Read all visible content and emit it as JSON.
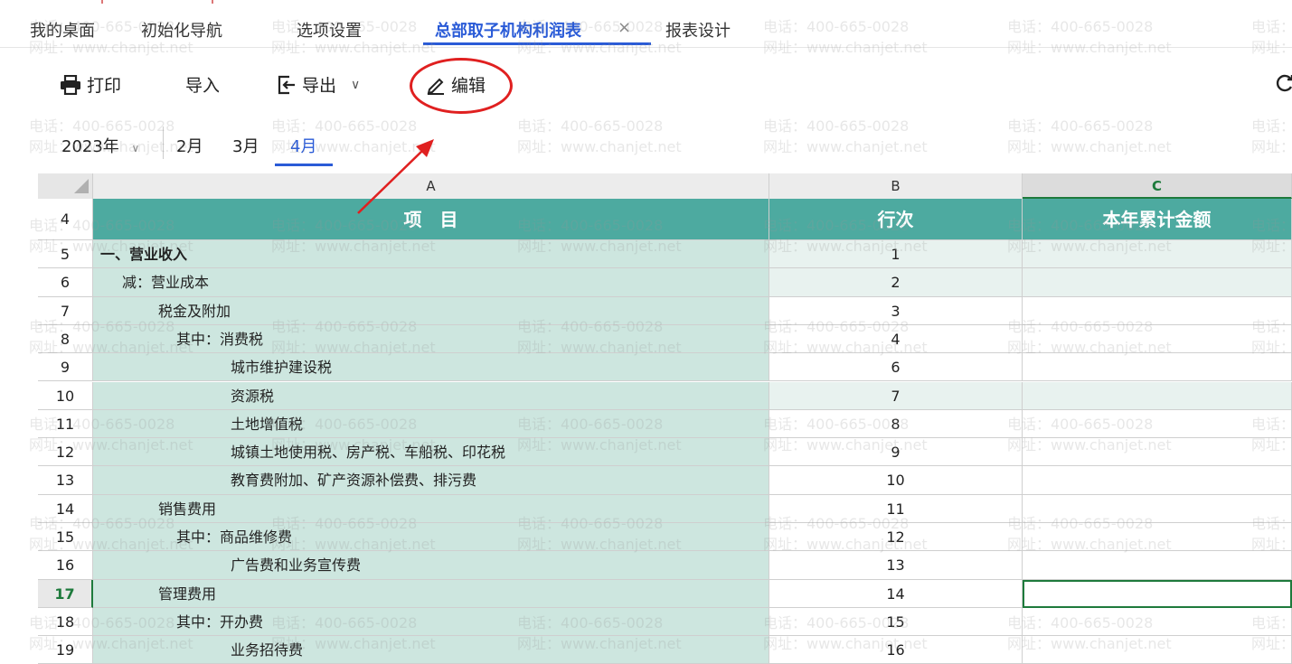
{
  "tabs": [
    {
      "label": "我的桌面",
      "active": false
    },
    {
      "label": "初始化导航",
      "active": false
    },
    {
      "label": "选项设置",
      "active": false
    },
    {
      "label": "总部取子机构利润表",
      "active": true,
      "closable": true
    },
    {
      "label": "报表设计",
      "active": false
    }
  ],
  "tab_close_glyph": "×",
  "toolbar": {
    "print_label": "打印",
    "import_label": "导入",
    "export_label": "导出",
    "export_caret": "∨",
    "edit_label": "编辑"
  },
  "period": {
    "year_label": "2023年",
    "year_caret": "∨",
    "months": [
      "2月",
      "3月",
      "4月"
    ],
    "active_month": "4月"
  },
  "grid": {
    "columns": [
      "A",
      "B",
      "C"
    ],
    "selected_column": "C",
    "selected_row": "17",
    "header_row": {
      "num": "4",
      "a": "项　目",
      "b": "行次",
      "c": "本年累计金额"
    },
    "rows": [
      {
        "num": "5",
        "a": "一、营业收入",
        "b": "1",
        "bold": true,
        "indent": 0,
        "shaded": true
      },
      {
        "num": "6",
        "a": "减：营业成本",
        "b": "2",
        "bold": false,
        "indent": 1,
        "shaded": true
      },
      {
        "num": "7",
        "a": "税金及附加",
        "b": "3",
        "bold": false,
        "indent": 2,
        "shaded": false
      },
      {
        "num": "8",
        "a": "其中：消费税",
        "b": "4",
        "bold": false,
        "indent": 3,
        "shaded": false
      },
      {
        "num": "9",
        "a": "城市维护建设税",
        "b": "6",
        "bold": false,
        "indent": 4,
        "shaded": false
      },
      {
        "num": "10",
        "a": "资源税",
        "b": "7",
        "bold": false,
        "indent": 4,
        "shaded": true
      },
      {
        "num": "11",
        "a": "土地增值税",
        "b": "8",
        "bold": false,
        "indent": 4,
        "shaded": false
      },
      {
        "num": "12",
        "a": "城镇土地使用税、房产税、车船税、印花税",
        "b": "9",
        "bold": false,
        "indent": 4,
        "shaded": false
      },
      {
        "num": "13",
        "a": "教育费附加、矿产资源补偿费、排污费",
        "b": "10",
        "bold": false,
        "indent": 4,
        "shaded": false
      },
      {
        "num": "14",
        "a": "销售费用",
        "b": "11",
        "bold": false,
        "indent": 2,
        "shaded": false
      },
      {
        "num": "15",
        "a": "其中：商品维修费",
        "b": "12",
        "bold": false,
        "indent": 3,
        "shaded": false
      },
      {
        "num": "16",
        "a": "广告费和业务宣传费",
        "b": "13",
        "bold": false,
        "indent": 4,
        "shaded": false
      },
      {
        "num": "17",
        "a": "管理费用",
        "b": "14",
        "bold": false,
        "indent": 2,
        "shaded": false
      },
      {
        "num": "18",
        "a": "其中：开办费",
        "b": "15",
        "bold": false,
        "indent": 3,
        "shaded": false
      },
      {
        "num": "19",
        "a": "业务招待费",
        "b": "16",
        "bold": false,
        "indent": 4,
        "shaded": false
      }
    ]
  },
  "watermark": {
    "line1": "电话：400-665-0028",
    "line2": "网址：www.chanjet.net"
  },
  "colors": {
    "accent": "#2a5bd7",
    "header_teal": "#4daaa0",
    "cell_teal": "#cde6df",
    "select_green": "#1e7a3c",
    "annotation_red": "#e02020"
  }
}
